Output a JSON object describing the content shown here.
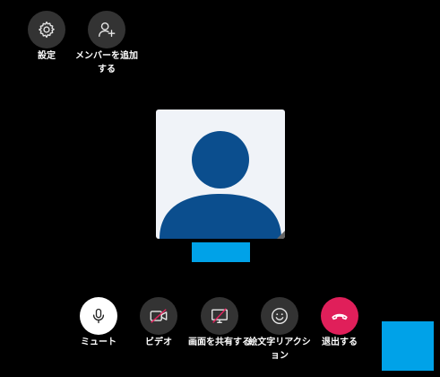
{
  "top_controls": {
    "settings_label": "設定",
    "add_member_label": "メンバーを追加する"
  },
  "call": {
    "participant_avatar_color": "#0b4e8e",
    "name_bar_color": "#00a2e8",
    "self_preview_color": "#00a2e8"
  },
  "toolbar": {
    "mute_label": "ミュート",
    "video_label": "ビデオ",
    "share_label": "画面を共有する",
    "emoji_label": "絵文字リアクション",
    "leave_label": "退出する"
  },
  "colors": {
    "background": "#000000",
    "button_dark": "#333333",
    "button_active": "#ffffff",
    "leave_red": "#e01f5a",
    "disabled_slash": "#e0245e"
  },
  "icons": [
    "gear-icon",
    "add-person-icon",
    "microphone-icon",
    "video-off-icon",
    "screen-share-off-icon",
    "emoji-icon",
    "hang-up-icon"
  ]
}
